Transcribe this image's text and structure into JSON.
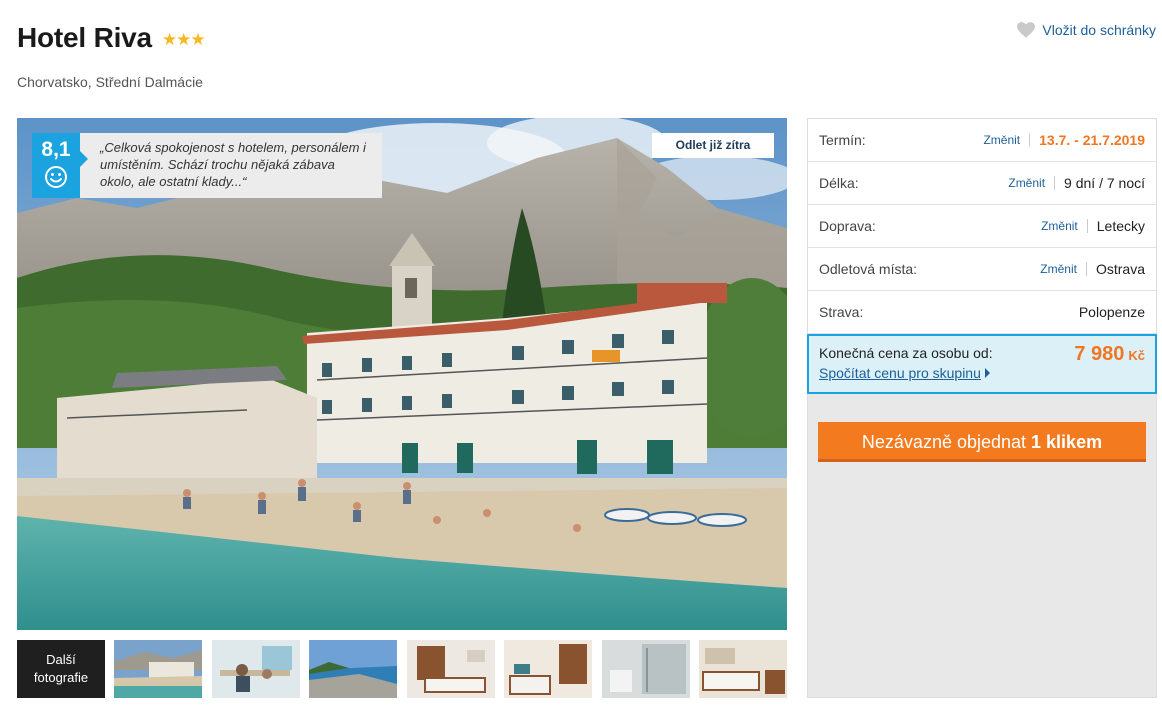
{
  "hotel": {
    "name": "Hotel Riva",
    "stars": "★★★",
    "location": "Chorvatsko, Střední Dalmácie"
  },
  "favorite": {
    "label": "Vložit do schránky",
    "icon": "heart-icon"
  },
  "photo": {
    "rating": "8,1",
    "review": "„Celková spokojenost s hotelem, personálem i umístěním. Schází trochu nějaká zábava okolo, ale ostatní klady...“",
    "departure_badge": "Odlet již zítra"
  },
  "thumbnails": {
    "more_label_line1": "Další",
    "more_label_line2": "fotografie",
    "count": 7
  },
  "params": {
    "change_label": "Změnit",
    "rows": [
      {
        "label": "Termín:",
        "value": "13.7. - 21.7.2019",
        "changeable": true
      },
      {
        "label": "Délka:",
        "value": "9 dní / 7 nocí",
        "changeable": true
      },
      {
        "label": "Doprava:",
        "value": "Letecky",
        "changeable": true
      },
      {
        "label": "Odletová místa:",
        "value": "Ostrava",
        "changeable": true
      },
      {
        "label": "Strava:",
        "value": "Polopenze",
        "changeable": false
      }
    ]
  },
  "price": {
    "label": "Konečná cena za osobu od:",
    "amount": "7 980",
    "currency": "Kč",
    "group_link": "Spočítat cenu pro skupinu"
  },
  "order": {
    "label_normal": "Nezávazně objednat ",
    "label_bold": "1 klikem"
  },
  "colors": {
    "accent_orange": "#f47a1f",
    "link_blue": "#1d5f98",
    "rating_blue": "#1aa3de",
    "star_yellow": "#f6b921"
  }
}
